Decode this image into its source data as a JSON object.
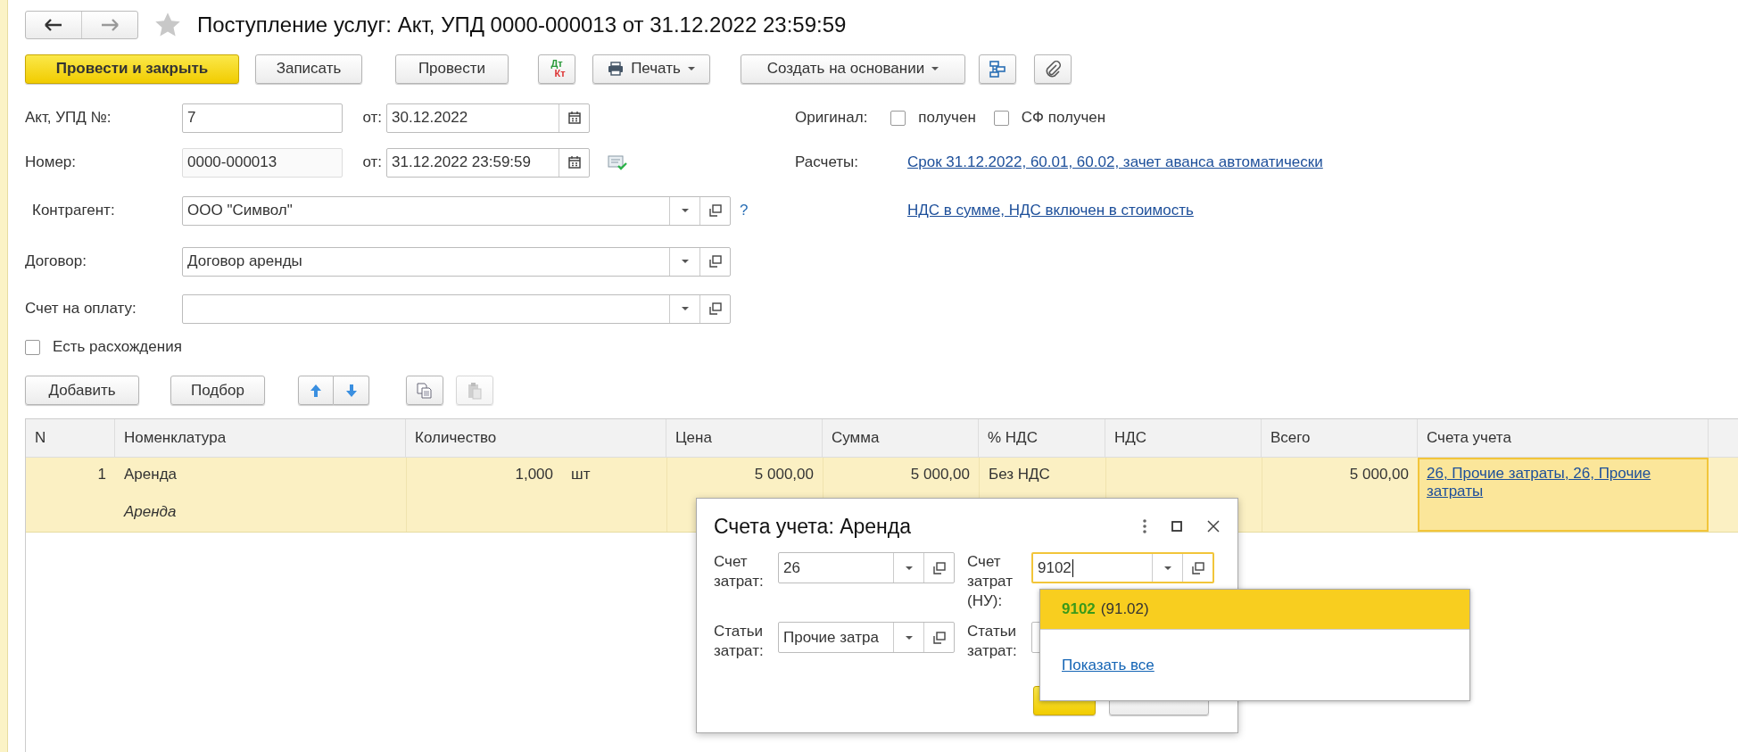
{
  "window": {
    "title": "Поступление услуг: Акт, УПД 0000-000013 от 31.12.2022 23:59:59"
  },
  "toolbar": [
    {
      "kind": "primary",
      "label": "Провести и закрыть"
    },
    {
      "kind": "button",
      "label": "Записать"
    },
    {
      "kind": "button",
      "label": "Провести"
    },
    {
      "kind": "dtkt",
      "top": "Дт",
      "bottom": "Кт"
    },
    {
      "kind": "print-menu",
      "label": "Печать"
    },
    {
      "kind": "menu",
      "label": "Создать на основании"
    },
    {
      "kind": "structure"
    },
    {
      "kind": "attach"
    }
  ],
  "act": {
    "label": "Акт, УПД №:",
    "value": "7",
    "date_label": "от:",
    "date": "30.12.2022"
  },
  "number": {
    "label": "Номер:",
    "value": "0000-000013",
    "date_label": "от:",
    "date": "31.12.2022 23:59:59"
  },
  "original": {
    "label": "Оригинал:",
    "checks": [
      {
        "label": "получен",
        "checked": false
      },
      {
        "label": "СФ получен",
        "checked": false
      }
    ]
  },
  "settlements": {
    "label": "Расчеты:",
    "link": "Срок 31.12.2022, 60.01, 60.02, зачет аванса автоматически"
  },
  "vat_link": "НДС в сумме, НДС включен в стоимость",
  "refs": [
    {
      "label": "Контрагент:",
      "value": "ООО \"Символ\"",
      "help": "?"
    },
    {
      "label": "Договор:",
      "value": "Договор аренды"
    },
    {
      "label": "Счет на оплату:"
    }
  ],
  "discrepancy": {
    "label": "Есть расхождения",
    "checked": false
  },
  "table_toolbar": [
    {
      "kind": "button",
      "label": "Добавить",
      "disabled": false
    },
    {
      "kind": "button",
      "label": "Подбор",
      "disabled": false
    },
    {
      "kind": "up",
      "disabled": false
    },
    {
      "kind": "down",
      "disabled": false
    },
    {
      "kind": "copy",
      "disabled": false
    },
    {
      "kind": "paste",
      "disabled": true
    }
  ],
  "table": {
    "columns": [
      "N",
      "Номенклатура",
      "Количество",
      "Цена",
      "Сумма",
      "% НДС",
      "НДС",
      "Всего",
      "Счета учета"
    ],
    "rows": [
      {
        "n": "1",
        "item": "Аренда",
        "item_detail": "Аренда",
        "qty": "1,000",
        "unit": "шт",
        "price": "5 000,00",
        "sum": "5 000,00",
        "vat_rate": "Без НДС",
        "total": "5 000,00",
        "accounts": "26, Прочие затраты, 26, Прочие затраты",
        "selected": true
      }
    ]
  },
  "dialog": {
    "title": "Счета учета: Аренда",
    "fields": [
      {
        "label": "Счет затрат:",
        "value": "26",
        "focused": false
      },
      {
        "label": "Счет затрат (НУ):",
        "value": "9102",
        "focused": true
      },
      {
        "label": "Статьи затрат:",
        "value": "Прочие затра",
        "focused": false
      },
      {
        "label": "Статьи затрат:",
        "focused": false
      }
    ],
    "buttons": [
      {
        "kind": "primary"
      },
      {
        "kind": "button"
      }
    ]
  },
  "dropdown": {
    "items": [
      {
        "code": "9102",
        "detail": "(91.02)",
        "selected": true
      }
    ],
    "show_all": "Показать все"
  }
}
